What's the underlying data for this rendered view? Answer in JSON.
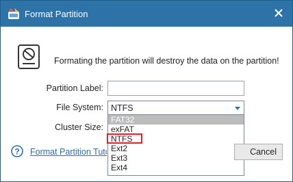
{
  "window": {
    "title": "Format Partition"
  },
  "icons": {
    "app": "format-partition-icon",
    "close": "close-icon",
    "warning": "disk-prohibited-icon",
    "help": "question-icon",
    "dropdown": "chevron-down-icon"
  },
  "warning": {
    "message": "Formating the partition will destroy the data on the partition!"
  },
  "form": {
    "partition_label": {
      "label": "Partition Label:",
      "value": ""
    },
    "file_system": {
      "label": "File System:",
      "value": "NTFS",
      "options": [
        "FAT32",
        "exFAT",
        "NTFS",
        "Ext2",
        "Ext3",
        "Ext4"
      ],
      "highlighted_option": "FAT32",
      "marked_option": "NTFS"
    },
    "cluster_size": {
      "label": "Cluster Size:"
    }
  },
  "footer": {
    "help_link": "Format Partition Tutorial",
    "cancel_label": "Cancel"
  },
  "colors": {
    "titlebar": "#2d73a8",
    "link": "#2a6db6",
    "marker": "#e02020",
    "hover": "#bcbcbc"
  }
}
